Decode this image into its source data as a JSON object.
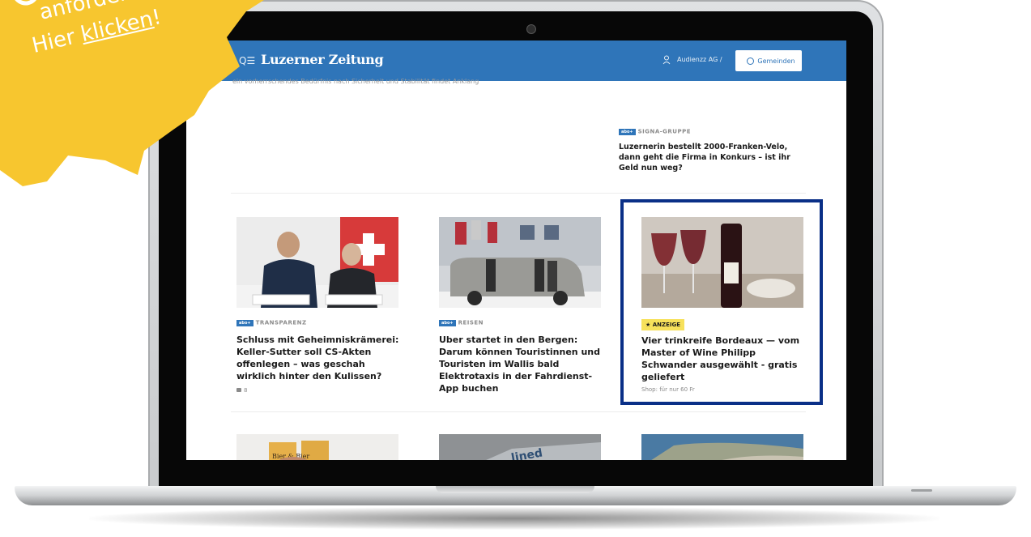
{
  "site": {
    "logo": "Luzerner Zeitung",
    "menu_icon": "search-menu-icon",
    "user_label": "Audienzz AG /",
    "gemeinden_label": "Gemeinden"
  },
  "top_story": {
    "cut_text": "ein vorherrschendes Bedürfnis nach Sicherheit und Stabilität findet Anklang",
    "badge": "abo+",
    "kicker": "SIGNA-GRUPPE",
    "headline": "Luzernerin bestellt 2000-Franken-Velo, dann geht die Firma in Konkurs – ist ihr Geld nun weg?"
  },
  "cards": [
    {
      "badge": "abo+",
      "kicker": "TRANSPARENZ",
      "headline": "Schluss mit Geheimniskrämerei: Keller-Sutter soll CS-Akten offenlegen – was geschah wirklich hinter den Kulissen?",
      "comments": "8"
    },
    {
      "badge": "abo+",
      "kicker": "REISEN",
      "headline": "Uber startet in den Bergen: Darum können Touristinnen und Touristen im Wallis bald Elektrotaxis in der Fahrdienst-App buchen"
    },
    {
      "ad_badge": "★ ANZEIGE",
      "headline": "Vier trinkreife Bordeaux — vom Master of Wine Philipp Schwander ausgewählt - gratis geliefert",
      "sponsor": "Shop: für nur 60 Fr"
    }
  ],
  "bottom_images": {
    "img4_text": "Bier & Bier",
    "img5_text": "lined"
  },
  "sticker": {
    "line1": "anfordern",
    "line2_prefix": "Hier ",
    "line2_link": "klicken",
    "line2_suffix": "!",
    "color": "#f7c62f"
  },
  "colors": {
    "header": "#2f75b9",
    "highlight_border": "#0a2f87",
    "ad_badge": "#f7e15b"
  }
}
